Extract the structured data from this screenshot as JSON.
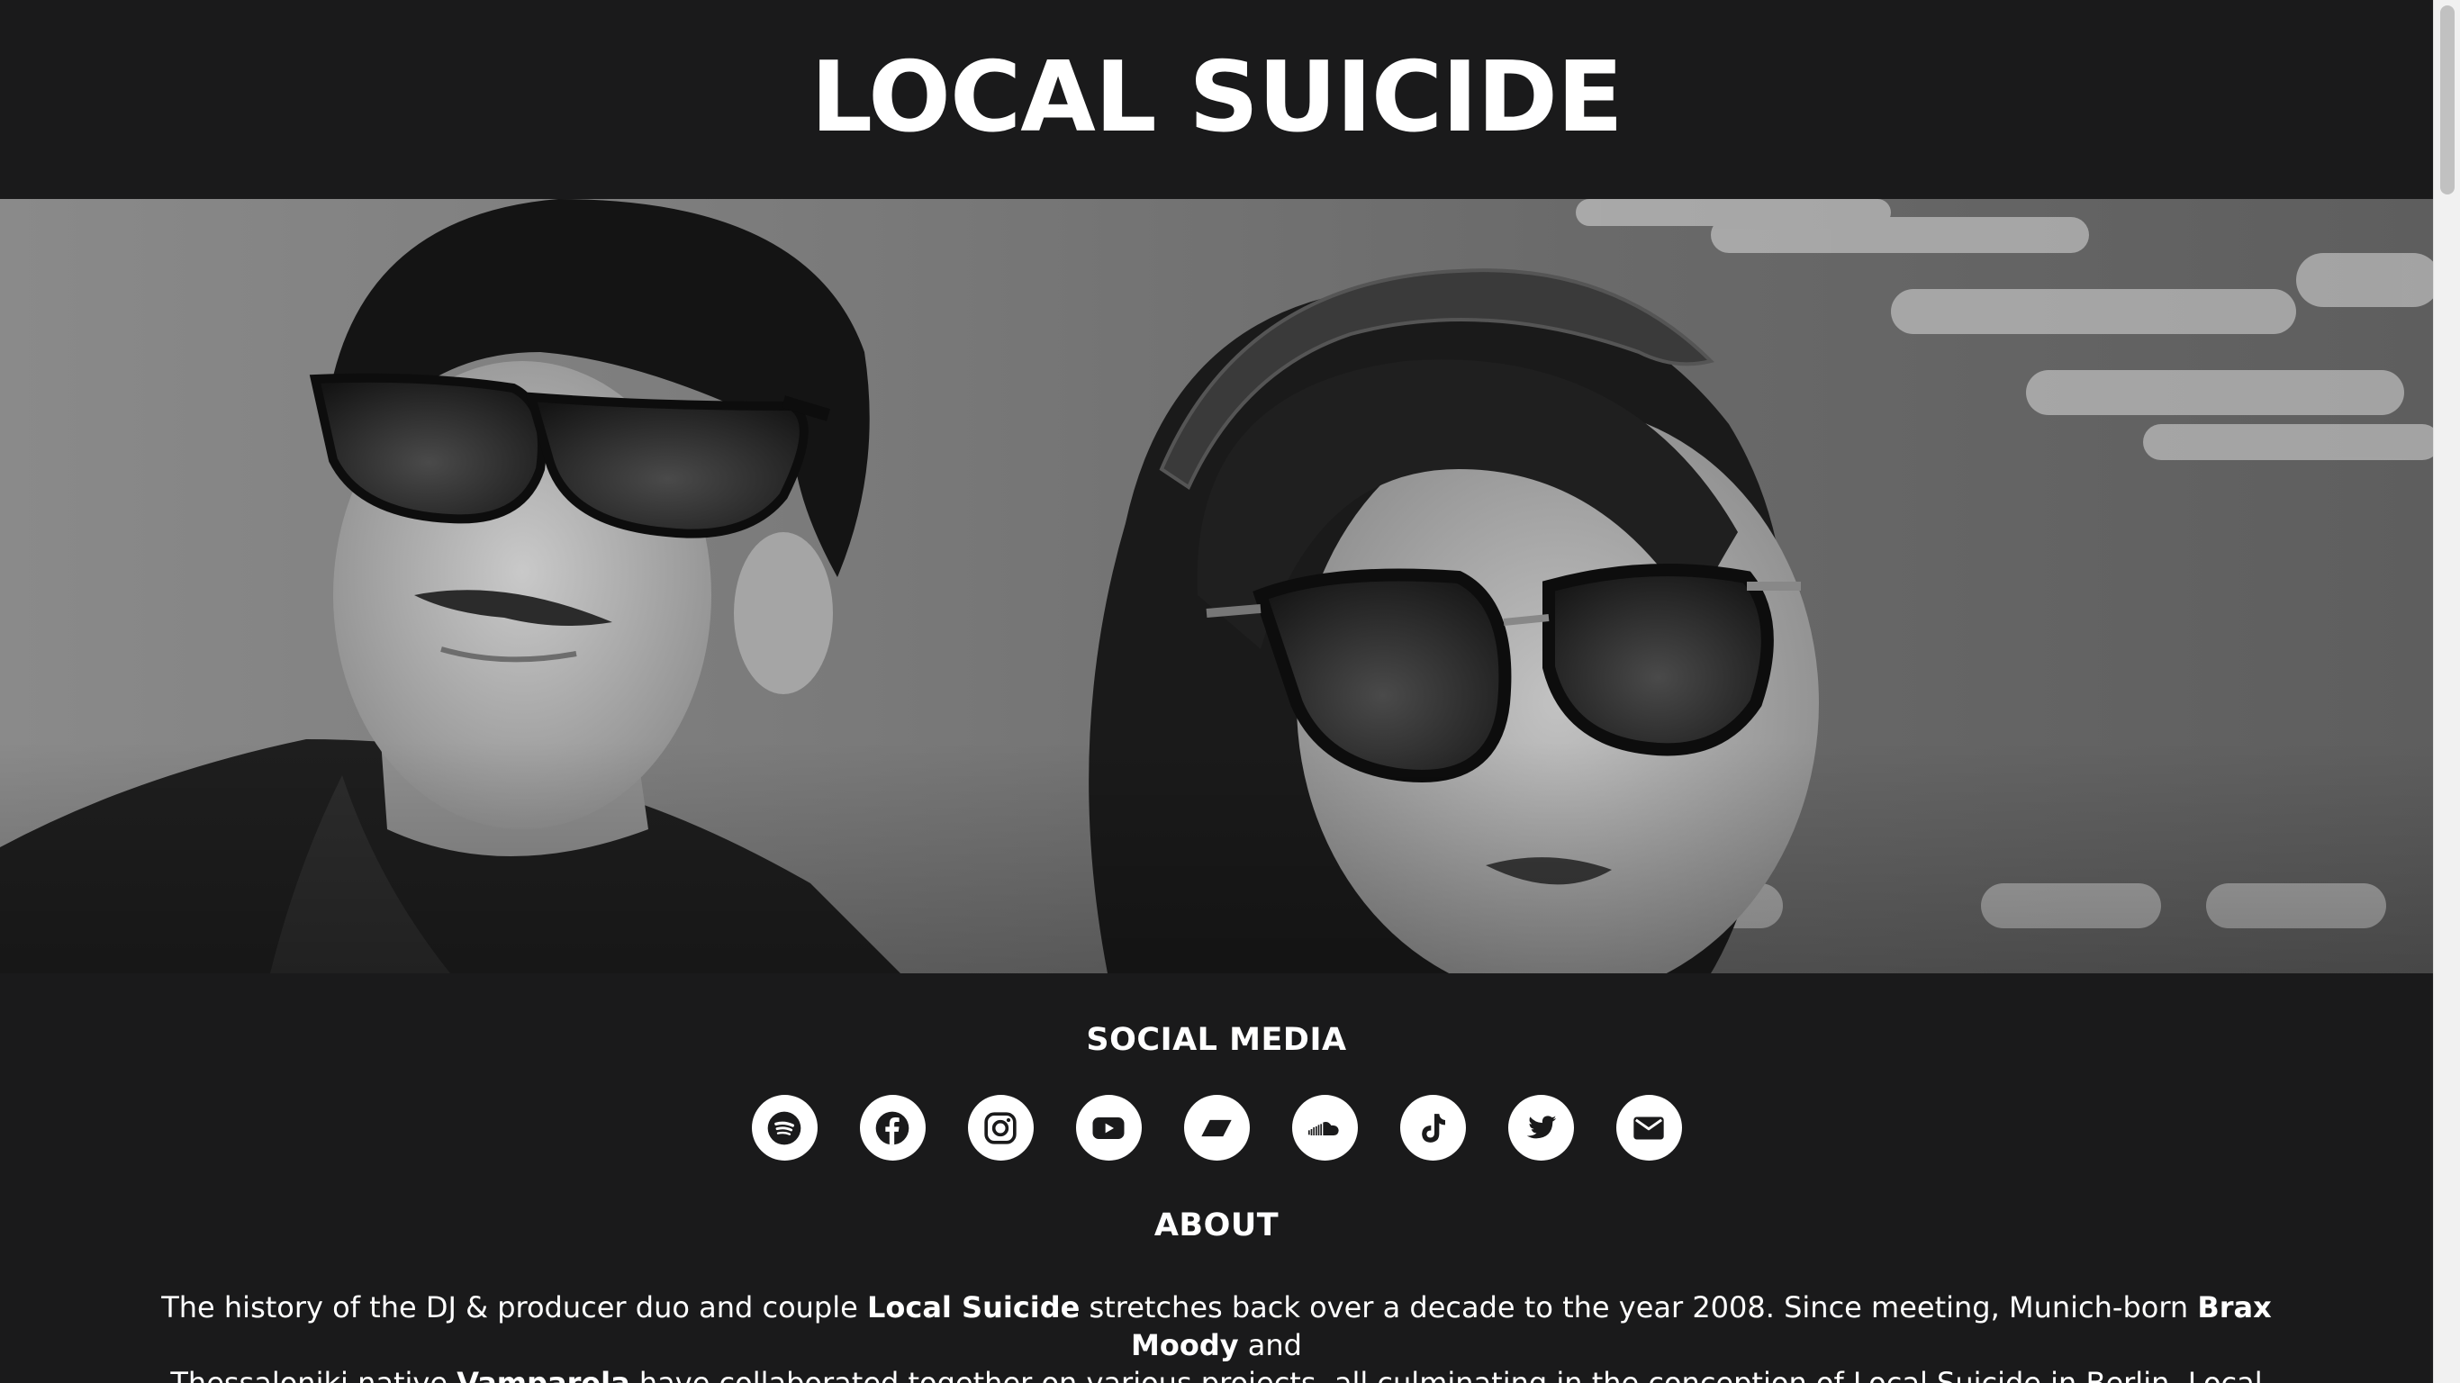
{
  "site": {
    "title": "LOCAL SUICIDE"
  },
  "hero": {
    "image_alt": "Black-and-white portrait of the DJ duo wearing sunglasses"
  },
  "social": {
    "heading": "SOCIAL MEDIA",
    "icons": [
      "spotify-icon",
      "facebook-icon",
      "instagram-icon",
      "youtube-icon",
      "bandcamp-icon",
      "soundcloud-icon",
      "tiktok-icon",
      "twitter-icon",
      "email-icon"
    ]
  },
  "about": {
    "heading": "ABOUT",
    "line1_a": "The history of the DJ & producer duo and couple ",
    "line1_b": "Local Suicide",
    "line1_c": " stretches back over a decade to the year 2008. Since meeting, Munich-born ",
    "line1_d": "Brax Moody",
    "line1_e": " and",
    "line2_a": "Thessaloniki native ",
    "line2_b": "Vamparela",
    "line2_c": " have collaborated together on various projects, all culminating in the conception of Local Suicide in Berlin. Local Suicide’s"
  },
  "colors": {
    "background": "#1a1a1b",
    "text": "#ffffff",
    "icon_bg": "#ffffff",
    "icon_fg": "#1a1a1b"
  }
}
